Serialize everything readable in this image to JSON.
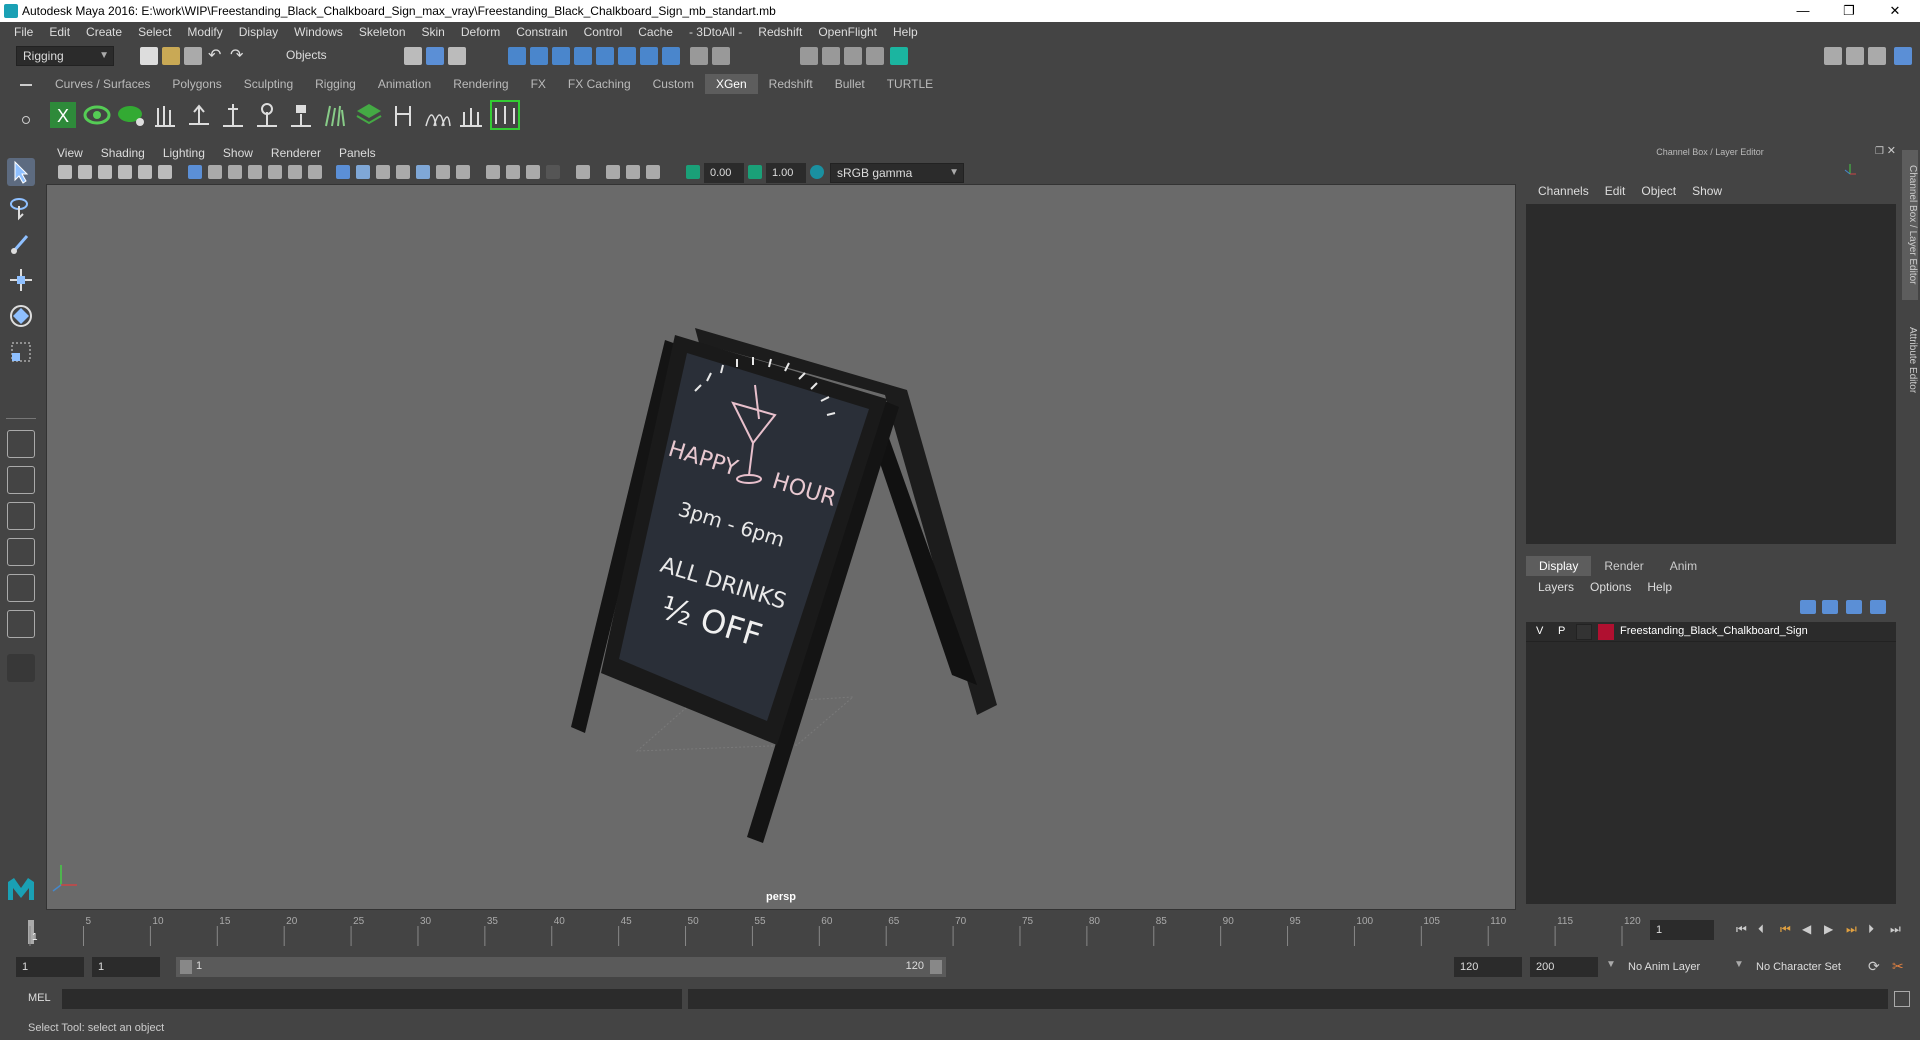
{
  "window": {
    "title": "Autodesk Maya 2016: E:\\work\\WIP\\Freestanding_Black_Chalkboard_Sign_max_vray\\Freestanding_Black_Chalkboard_Sign_mb_standart.mb",
    "minimize": "—",
    "maximize": "❐",
    "close": "✕"
  },
  "menubar": [
    "File",
    "Edit",
    "Create",
    "Select",
    "Modify",
    "Display",
    "Windows",
    "Skeleton",
    "Skin",
    "Deform",
    "Constrain",
    "Control",
    "Cache",
    "- 3DtoAll -",
    "Redshift",
    "OpenFlight",
    "Help"
  ],
  "statusline": {
    "mode": "Rigging",
    "selection_mode": "Objects"
  },
  "shelf": {
    "tabs": [
      "Curves / Surfaces",
      "Polygons",
      "Sculpting",
      "Rigging",
      "Animation",
      "Rendering",
      "FX",
      "FX Caching",
      "Custom",
      "XGen",
      "Redshift",
      "Bullet",
      "TURTLE"
    ],
    "active_tab": "XGen"
  },
  "viewport": {
    "menus": [
      "View",
      "Shading",
      "Lighting",
      "Show",
      "Renderer",
      "Panels"
    ],
    "exposure": "0.00",
    "gamma": "1.00",
    "color_space": "sRGB gamma",
    "camera_label": "persp",
    "scene": {
      "line1": "HAPPY",
      "line1b": "HOUR",
      "line2": "3pm - 6pm",
      "line3": "ALL DRINKS",
      "line4": "½ OFF"
    }
  },
  "channel_box": {
    "title": "Channel Box / Layer Editor",
    "menus": [
      "Channels",
      "Edit",
      "Object",
      "Show"
    ]
  },
  "layer_editor": {
    "tabs": [
      "Display",
      "Render",
      "Anim"
    ],
    "active_tab": "Display",
    "menus": [
      "Layers",
      "Options",
      "Help"
    ],
    "layers": [
      {
        "v": "V",
        "p": "P",
        "color": "#b01030",
        "name": "Freestanding_Black_Chalkboard_Sign"
      }
    ]
  },
  "side_tabs": [
    "Channel Box / Layer Editor",
    "Attribute Editor"
  ],
  "timeline": {
    "ticks": [
      "1",
      "5",
      "10",
      "15",
      "20",
      "25",
      "30",
      "35",
      "40",
      "45",
      "50",
      "55",
      "60",
      "65",
      "70",
      "75",
      "80",
      "85",
      "90",
      "95",
      "100",
      "105",
      "110",
      "115",
      "120"
    ],
    "current_frame": "1"
  },
  "range": {
    "start": "1",
    "playback_start": "1",
    "slider_start": "1",
    "slider_end": "120",
    "playback_end": "120",
    "end": "200",
    "anim_layer": "No Anim Layer",
    "character_set": "No Character Set"
  },
  "command_line": {
    "label": "MEL"
  },
  "help_line": "Select Tool: select an object"
}
